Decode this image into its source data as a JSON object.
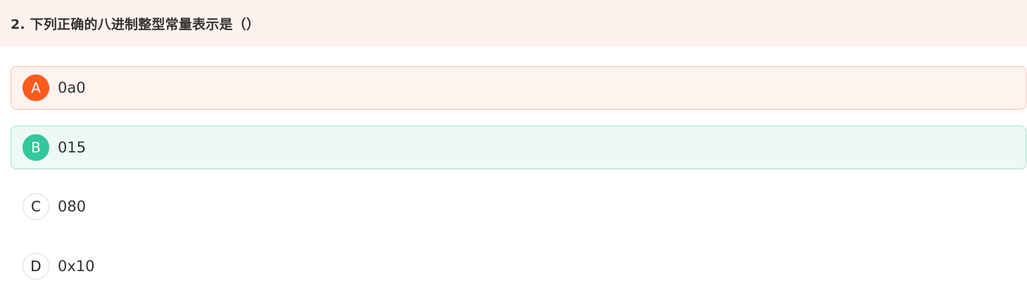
{
  "question": {
    "title": "2. 下列正确的八进制整型常量表示是（）"
  },
  "options": [
    {
      "letter": "A",
      "text": "0a0",
      "state": "wrong"
    },
    {
      "letter": "B",
      "text": "015",
      "state": "correct"
    },
    {
      "letter": "C",
      "text": "080",
      "state": "default"
    },
    {
      "letter": "D",
      "text": "0x10",
      "state": "default"
    }
  ],
  "colors": {
    "header_bg": "#fef2ee",
    "wrong_accent": "#fd5a1e",
    "wrong_bg": "#fff3f0",
    "correct_accent": "#33c89a",
    "correct_bg": "#edf9f5"
  }
}
